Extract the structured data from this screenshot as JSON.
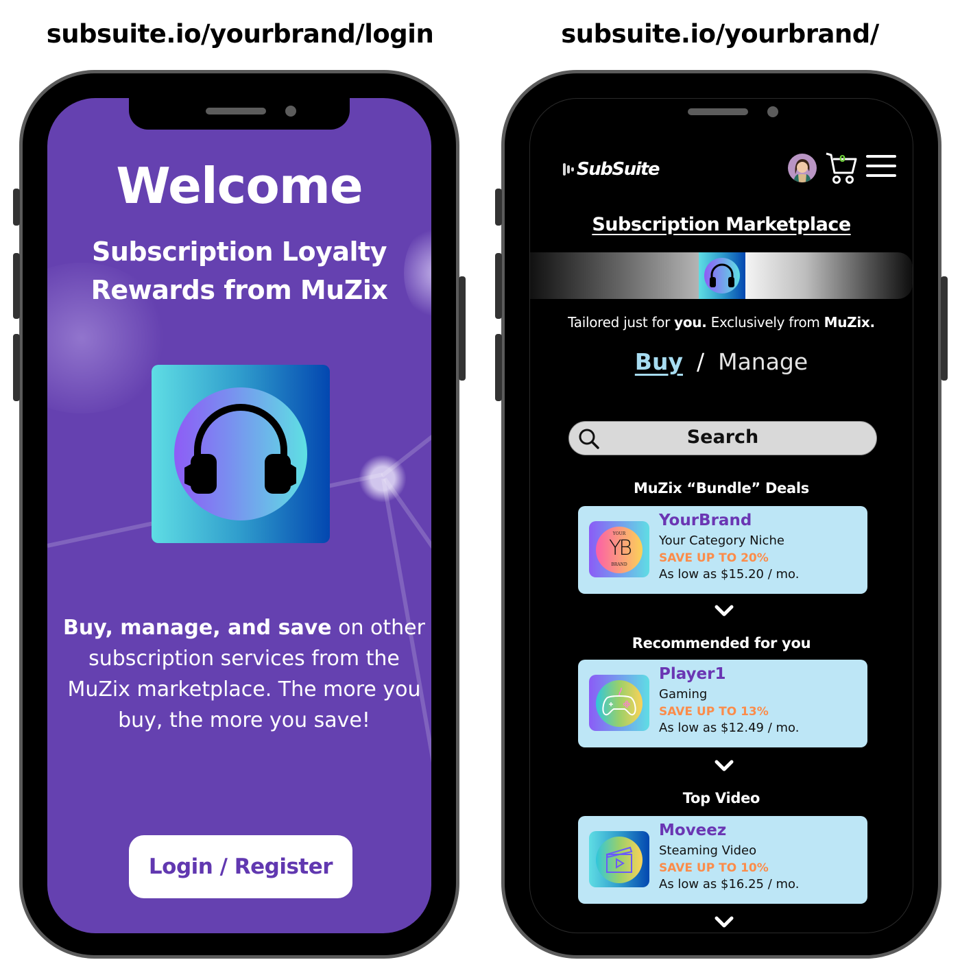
{
  "labels": {
    "left_url": "subsuite.io/yourbrand/login",
    "right_url": "subsuite.io/yourbrand/"
  },
  "login_screen": {
    "title": "Welcome",
    "subtitle_line1": "Subscription Loyalty",
    "subtitle_line2": "Rewards from MuZix",
    "app_icon": "headphones-icon",
    "description_bold": "Buy, manage, and save",
    "description_rest": " on other subscription services from the MuZix marketplace. The more you buy, the more you save!",
    "login_button": "Login / Register",
    "colors": {
      "background": "#6541b0",
      "button_text": "#6138b0"
    }
  },
  "marketplace_screen": {
    "logo": "SubSuite",
    "cart_count": "0",
    "title": "Subscription Marketplace",
    "tagline": {
      "part1": "Tailored just for ",
      "bold1": "you.",
      "part2": " Exclusively from ",
      "bold2": "MuZix."
    },
    "tabs": {
      "buy": "Buy",
      "separator": "/",
      "manage": "Manage",
      "active": "Buy"
    },
    "search": {
      "placeholder": "Search"
    },
    "sections": [
      {
        "title": "MuZix “Bundle” Deals",
        "card": {
          "name": "YourBrand",
          "category": "Your Category Niche",
          "save": "SAVE UP TO 20%",
          "price": "As low as $15.20 / mo.",
          "icon": "yourbrand-logo-icon",
          "icon_top_text": "YOUR",
          "icon_mid_text": "YB",
          "icon_bottom_text": "BRAND"
        }
      },
      {
        "title": "Recommended for you",
        "card": {
          "name": "Player1",
          "category": "Gaming",
          "save": "SAVE UP TO 13%",
          "price": "As low as $12.49 / mo.",
          "icon": "game-controller-icon"
        }
      },
      {
        "title": "Top Video",
        "card": {
          "name": "Moveez",
          "category": "Steaming Video",
          "save": "SAVE UP TO 10%",
          "price": "As low as $16.25 / mo.",
          "icon": "clapperboard-icon"
        }
      }
    ],
    "colors": {
      "card_bg": "#bde6f6",
      "card_name": "#6a36b3",
      "save_text": "#fb8c4a",
      "buy_tab": "#a7dcf1",
      "cart_count": "#72d63b"
    }
  }
}
